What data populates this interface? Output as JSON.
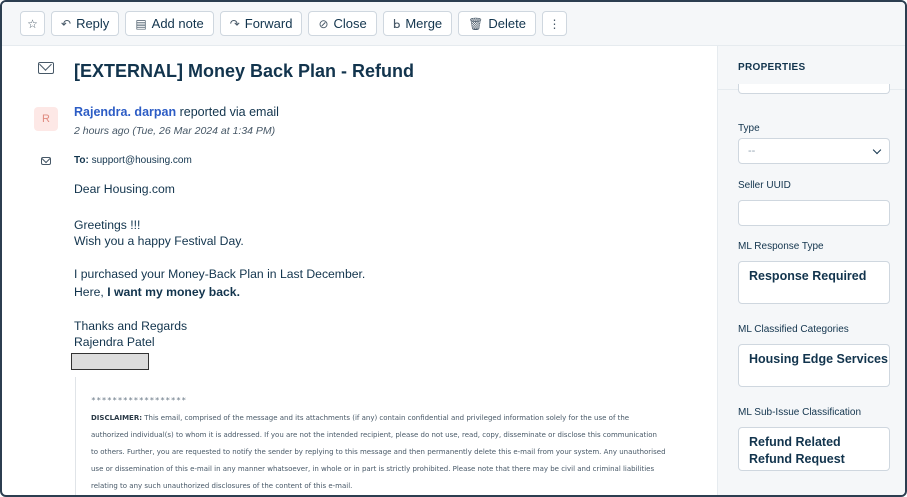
{
  "toolbar": {
    "star_icon": "star-icon",
    "reply": {
      "icon": "reply-icon",
      "label": "Reply"
    },
    "add_note": {
      "icon": "note-icon",
      "label": "Add note"
    },
    "forward": {
      "icon": "forward-icon",
      "label": "Forward"
    },
    "close": {
      "icon": "check-circle-icon",
      "label": "Close"
    },
    "merge": {
      "icon": "merge-icon",
      "label": "Merge"
    },
    "delete": {
      "icon": "trash-icon",
      "label": "Delete"
    },
    "more_icon": "more-vertical-icon"
  },
  "ticket": {
    "subject": "[EXTERNAL] Money Back Plan - Refund",
    "avatar_initial": "R",
    "sender_name": "Rajendra. darpan",
    "sender_suffix": "reported via email",
    "timestamp": "2 hours ago (Tue, 26 Mar 2024 at 1:34 PM)",
    "to_label": "To:",
    "to_address": "support@housing.com"
  },
  "email_body": {
    "line1": "Dear Housing.com",
    "line2": "Greetings !!!",
    "line3": "Wish you a happy Festival Day.",
    "line4": "I purchased your Money-Back Plan in Last December.",
    "line5_prefix": "Here, ",
    "line5_bold": "I want my money back.",
    "line6": "Thanks and Regards",
    "line7": "Rajendra Patel"
  },
  "disclaimer": {
    "stars": "******************",
    "label": "DISCLAIMER:",
    "text": "This email, comprised of the message and its attachments (if any) contain confidential and privileged information solely for the use of the authorized individual(s) to whom it is addressed. If you are not the intended recipient, please do not use, read, copy, disseminate or disclose this communication to others. Further, you are requested to notify the sender by replying to this message and then permanently delete this e-mail from your system.  Any unauthorised use or dissemination of this e-mail in any manner whatsoever, in whole or in part is strictly prohibited. Please note that there may be civil and criminal liabilities relating to any such unauthorized disclosures of the content of this e-mail."
  },
  "properties": {
    "title": "PROPERTIES",
    "type_label": "Type",
    "type_value": "--",
    "seller_uuid_label": "Seller UUID",
    "seller_uuid_value": "",
    "ml_response_type_label": "ML Response Type",
    "ml_response_type_value": "Response Required",
    "ml_classified_label": "ML Classified Categories",
    "ml_classified_value": "Housing Edge Services",
    "ml_subissue_label": "ML Sub-Issue Classification",
    "ml_subissue_line1": "Refund Related",
    "ml_subissue_line2": "Refund Request"
  }
}
